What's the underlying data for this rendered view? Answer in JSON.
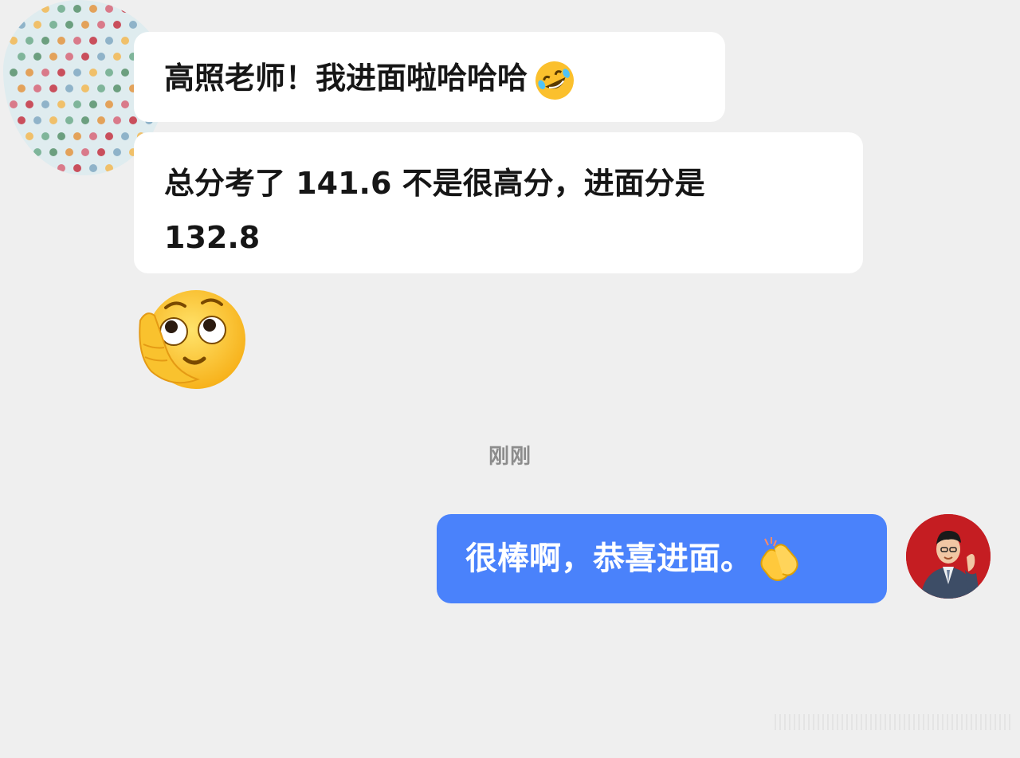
{
  "messages": {
    "incoming_1": {
      "text": "高照老师！我进面啦哈哈哈",
      "emoji": "rolling-on-floor-laughing-icon"
    },
    "incoming_2": {
      "line1": "总分考了 141.6 不是很高分，进面分是",
      "line2": "132.8"
    },
    "incoming_3": {
      "emoji": "hand-on-face-thinking-icon"
    },
    "timestamp": "刚刚",
    "outgoing_1": {
      "text": "很棒啊，恭喜进面。",
      "emoji": "clapping-hands-icon"
    }
  },
  "colors": {
    "background": "#efefef",
    "incoming_bubble": "#ffffff",
    "outgoing_bubble": "#4a82fb",
    "avatar_right_bg": "#c51d22"
  }
}
